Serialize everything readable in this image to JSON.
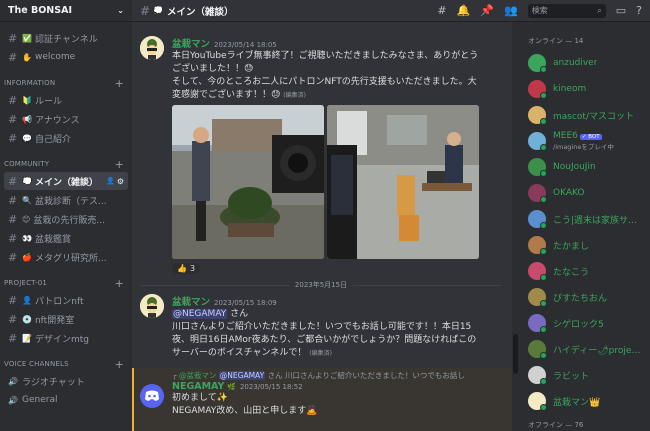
{
  "server": {
    "name": "The BONSAI"
  },
  "channels_top": [
    {
      "emoji": "✅",
      "label": "認証チャンネル"
    },
    {
      "emoji": "✋",
      "label": "welcome"
    }
  ],
  "categories": {
    "information": "INFORMATION",
    "community": "COMMUNITY",
    "project": "PROJECT-01",
    "voice": "VOICE CHANNELS"
  },
  "info_channels": [
    {
      "emoji": "🔰",
      "label": "ルール"
    },
    {
      "emoji": "📢",
      "label": "アナウンス"
    },
    {
      "emoji": "💬",
      "label": "自己紹介"
    }
  ],
  "community_channels": [
    {
      "emoji": "💭",
      "label": "メイン（雑談）"
    },
    {
      "emoji": "🔍",
      "label": "盆栽診断（テス..."
    },
    {
      "emoji": "😊",
      "label": "盆栽の先行販売..."
    },
    {
      "emoji": "👀",
      "label": "盆栽鑑賞"
    },
    {
      "emoji": "🍎",
      "label": "メタグリ研究所..."
    }
  ],
  "project_channels": [
    {
      "emoji": "👤",
      "label": "パトロンnft"
    },
    {
      "emoji": "💿",
      "label": "nft開発室"
    },
    {
      "emoji": "📝",
      "label": "デザインmtg"
    }
  ],
  "voice_channels": [
    {
      "label": "ラジオチャット"
    },
    {
      "label": "General"
    }
  ],
  "topbar": {
    "channel_title": "メイン（雑談）",
    "search_placeholder": "検索"
  },
  "messages": {
    "m1": {
      "author": "盆栽マン",
      "timestamp": "2023/05/14 18:05",
      "lines": [
        "本日YouTubeライブ無事終了！ご視聴いただきましたみなさま、ありがとう",
        "ございました！！😓",
        "そして、今のところお二人にパトロンNFTの先行支援もいただきました。大",
        "変感謝でございます！！😓"
      ],
      "edited": "(編集済)",
      "reaction_emoji": "👍",
      "reaction_count": "3"
    },
    "divider_date": "2023年5月15日",
    "m2": {
      "author": "盆栽マン",
      "timestamp": "2023/05/15 18:09",
      "mention": "@NEGAMAY",
      "mention_suffix": "さん",
      "lines": [
        "川口さんよりご紹介いただきました！いつでもお話し可能です！！本日15",
        "夜、明日16日AMor夜あたり、ご都合いかがでしょうか？問題なければこの",
        "サーバーのボイスチャンネルで！"
      ],
      "edited": "(編集済)"
    },
    "m3": {
      "reply_author": "@盆栽マン",
      "reply_mention": "@NEGAMAY",
      "reply_text": "さん 川口さんよりご紹介いただきました！いつでもお話し",
      "author": "NEGAMAY",
      "timestamp": "2023/05/15 18:52",
      "lines": [
        "初めまして✨",
        "NEGAMAY改め、山田と申します🙇"
      ]
    }
  },
  "members": {
    "online_header": "オンライン — 14",
    "list": [
      {
        "name": "anzudiver",
        "sub": "",
        "color": "#3ba55c"
      },
      {
        "name": "kineom",
        "sub": "",
        "color": "#3ba55c"
      },
      {
        "name": "mascot/マスコット",
        "sub": "",
        "color": "#3ba55c"
      },
      {
        "name": "MEE6",
        "sub": "/imagineをプレイ中",
        "color": "#3ba55c",
        "bot": "✓ BOT"
      },
      {
        "name": "NouJouJin",
        "sub": "",
        "color": "#3ba55c"
      },
      {
        "name": "OKAKO",
        "sub": "",
        "color": "#3ba55c"
      },
      {
        "name": "こう|週末は家族サー...",
        "sub": "",
        "color": "#3ba55c"
      },
      {
        "name": "たかまし",
        "sub": "",
        "color": "#3ba55c"
      },
      {
        "name": "たなこう",
        "sub": "",
        "color": "#3ba55c"
      },
      {
        "name": "ぴすたちおん",
        "sub": "",
        "color": "#3ba55c"
      },
      {
        "name": "シゲロック5",
        "sub": "",
        "color": "#3ba55c"
      },
      {
        "name": "ハイディー🌶project ...",
        "sub": "",
        "color": "#3ba55c"
      },
      {
        "name": "ラビット",
        "sub": "",
        "color": "#3ba55c"
      },
      {
        "name": "盆栽マン👑",
        "sub": "",
        "color": "#3ba55c"
      }
    ],
    "offline_header": "オフライン — 76"
  },
  "colors": {
    "accent": "#5865f2",
    "online": "#23a55a",
    "username_green": "#3ba55c"
  }
}
